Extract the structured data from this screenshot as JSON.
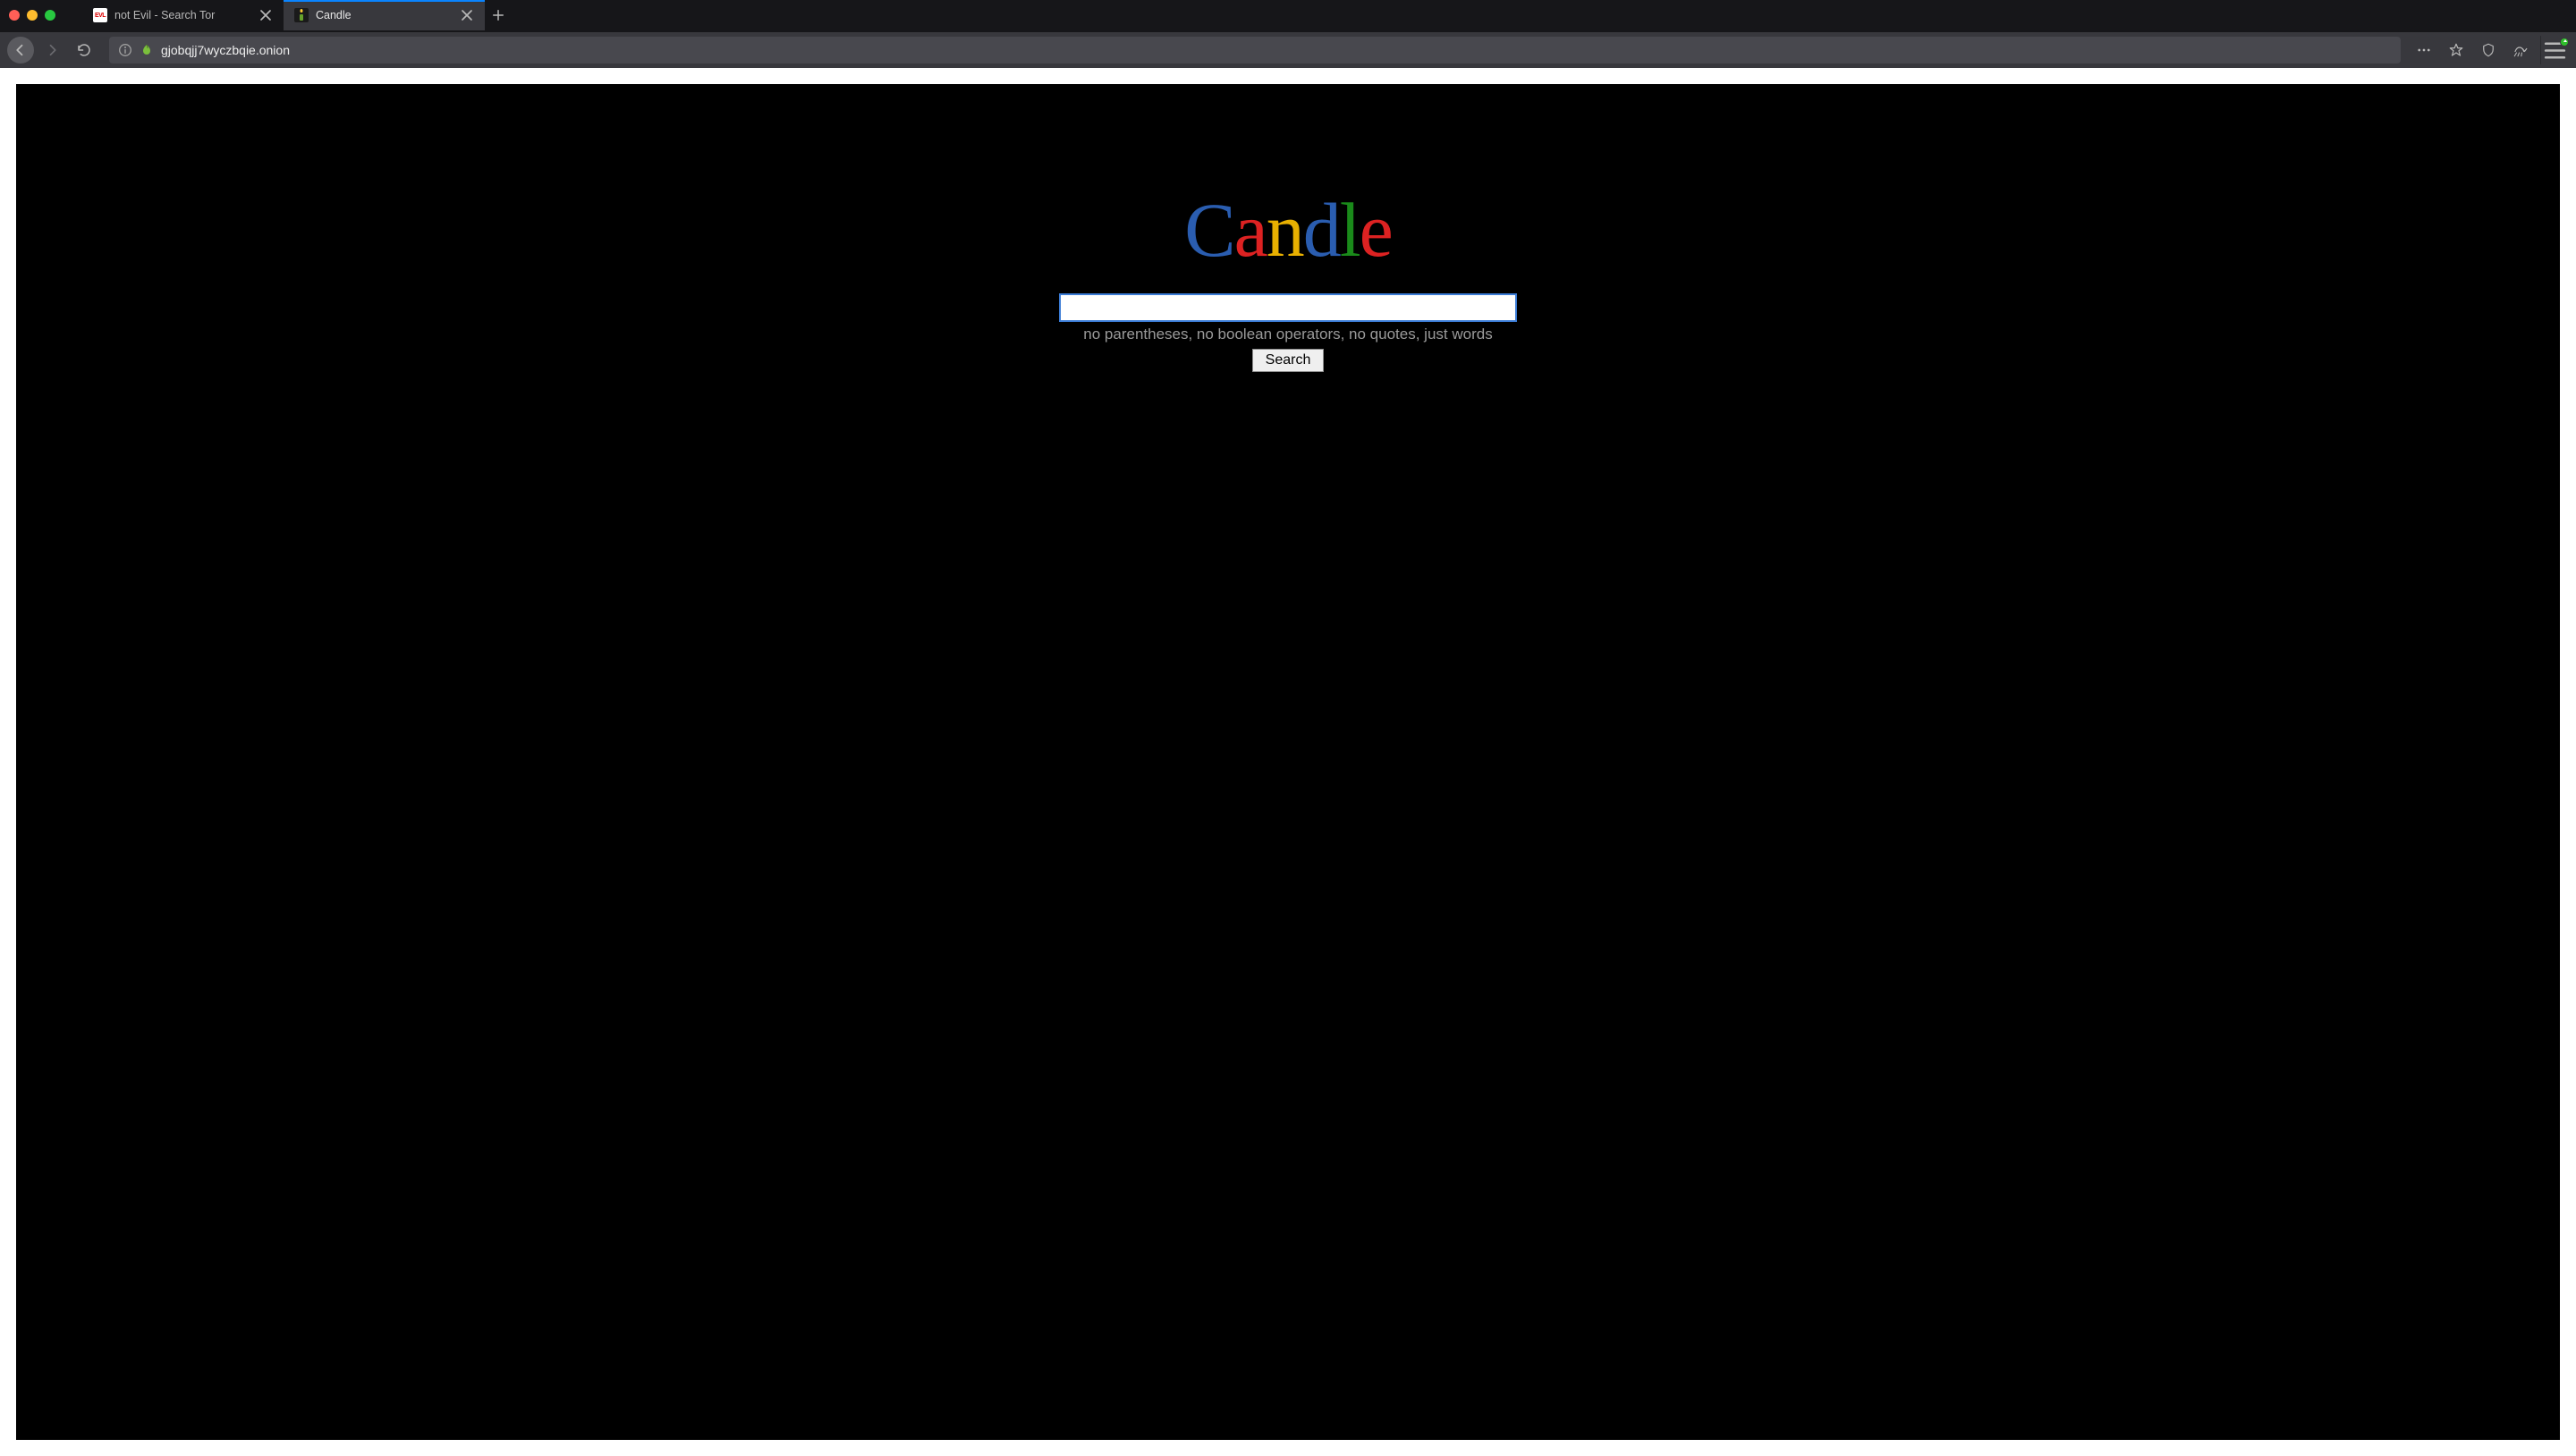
{
  "browser": {
    "tabs": [
      {
        "title": "not Evil - Search Tor",
        "active": false
      },
      {
        "title": "Candle",
        "active": true
      }
    ],
    "url": "gjobqjj7wyczbqie.onion"
  },
  "page": {
    "logo_letters": [
      "C",
      "a",
      "n",
      "d",
      "l",
      "e"
    ],
    "hint": "no parentheses, no boolean operators, no quotes, just words",
    "search_button": "Search",
    "search_value": ""
  }
}
